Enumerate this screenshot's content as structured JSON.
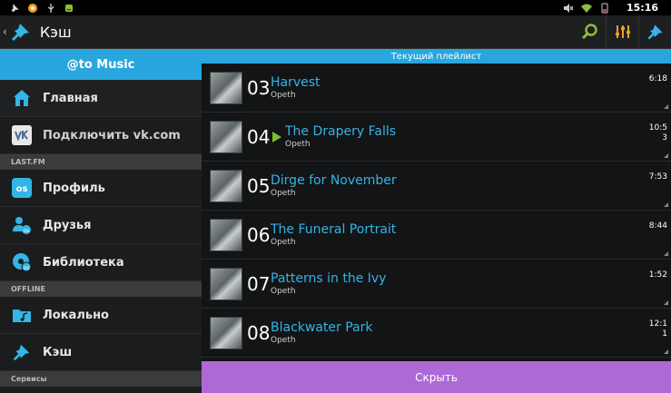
{
  "status": {
    "time": "15:16"
  },
  "actionbar": {
    "title": "Кэш"
  },
  "sidebar": {
    "header": "@to Music",
    "items": [
      {
        "label": "Главная"
      },
      {
        "label": "Подключить vk.com"
      },
      {
        "label": "Профиль"
      },
      {
        "label": "Друзья"
      },
      {
        "label": "Библиотека"
      },
      {
        "label": "Локально"
      },
      {
        "label": "Кэш"
      }
    ],
    "sections": [
      "LAST.FM",
      "OFFLINE",
      "Сервисы"
    ]
  },
  "playlist": {
    "header": "Текущий плейлист",
    "tracks": [
      {
        "num": "03",
        "title": "Harvest",
        "artist": "Opeth",
        "duration": "6:18"
      },
      {
        "num": "04",
        "title": "The Drapery Falls",
        "artist": "Opeth",
        "duration": "10:53"
      },
      {
        "num": "05",
        "title": "Dirge for November",
        "artist": "Opeth",
        "duration": "7:53"
      },
      {
        "num": "06",
        "title": "The Funeral Portrait",
        "artist": "Opeth",
        "duration": "8:44"
      },
      {
        "num": "07",
        "title": "Patterns in the Ivy",
        "artist": "Opeth",
        "duration": "1:52"
      },
      {
        "num": "08",
        "title": "Blackwater Park",
        "artist": "Opeth",
        "duration": "12:11"
      }
    ],
    "hide_label": "Скрыть"
  },
  "colors": {
    "accent": "#29a6de",
    "link": "#33b5e5",
    "play": "#7fbf2c",
    "hide": "#ad6ad6"
  }
}
